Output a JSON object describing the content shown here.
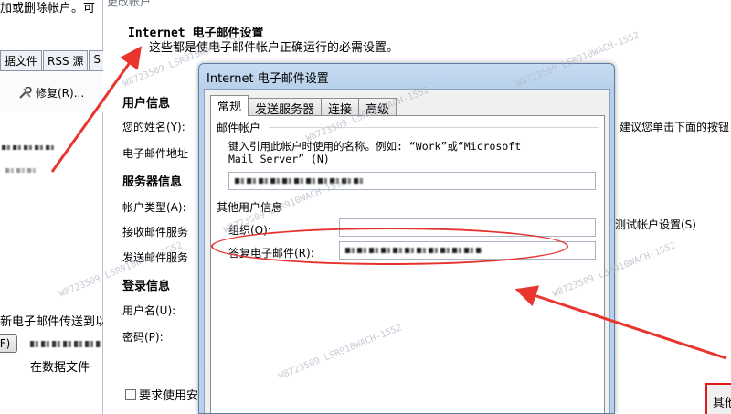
{
  "left_window": {
    "title": "加或删除帐户。可",
    "tabs": [
      "据文件",
      "RSS 源",
      "S"
    ],
    "repair_label": "修复(R)...",
    "message": "新电子邮件传送到以",
    "button_label": "F)",
    "data_file_label": "在数据文件"
  },
  "mid_window": {
    "window_title": "更改帐户",
    "header_title": "Internet 电子邮件设置",
    "header_subtitle": "这些都是使电子邮件帐户正确运行的必需设置。",
    "user_info_section": "用户信息",
    "your_name_label": "您的姓名(Y):",
    "email_label": "电子邮件地址",
    "server_info_section": "服务器信息",
    "account_type_label": "帐户类型(A):",
    "incoming_label": "接收邮件服务",
    "outgoing_label": "发送邮件服务",
    "login_info_section": "登录信息",
    "username_label": "用户名(U):",
    "password_label": "密码(P):",
    "right_hint": "建议您单击下面的按钮",
    "test_settings": "测试帐户设置(S)",
    "require_checkbox": "要求使用安",
    "other_settings_button": "其他"
  },
  "dialog": {
    "title": "Internet 电子邮件设置",
    "tabs": [
      "常规",
      "发送服务器",
      "连接",
      "高级"
    ],
    "mail_account_group": "邮件帐户",
    "mail_account_desc_line1": "键入引用此帐户时使用的名称。例如: “Work”或“Microsoft",
    "mail_account_desc_line2": "Mail Server” (N)",
    "other_user_info_group": "其他用户信息",
    "organization_label": "组织(O):",
    "reply_email_label": "答复电子邮件(R):"
  },
  "watermark": "W8723509 LSR910WACH-1552",
  "colors": {
    "annotation_red": "#e31818",
    "dialog_frame": "#b9d1ec"
  },
  "icons": {
    "repair": "repair-icon"
  }
}
